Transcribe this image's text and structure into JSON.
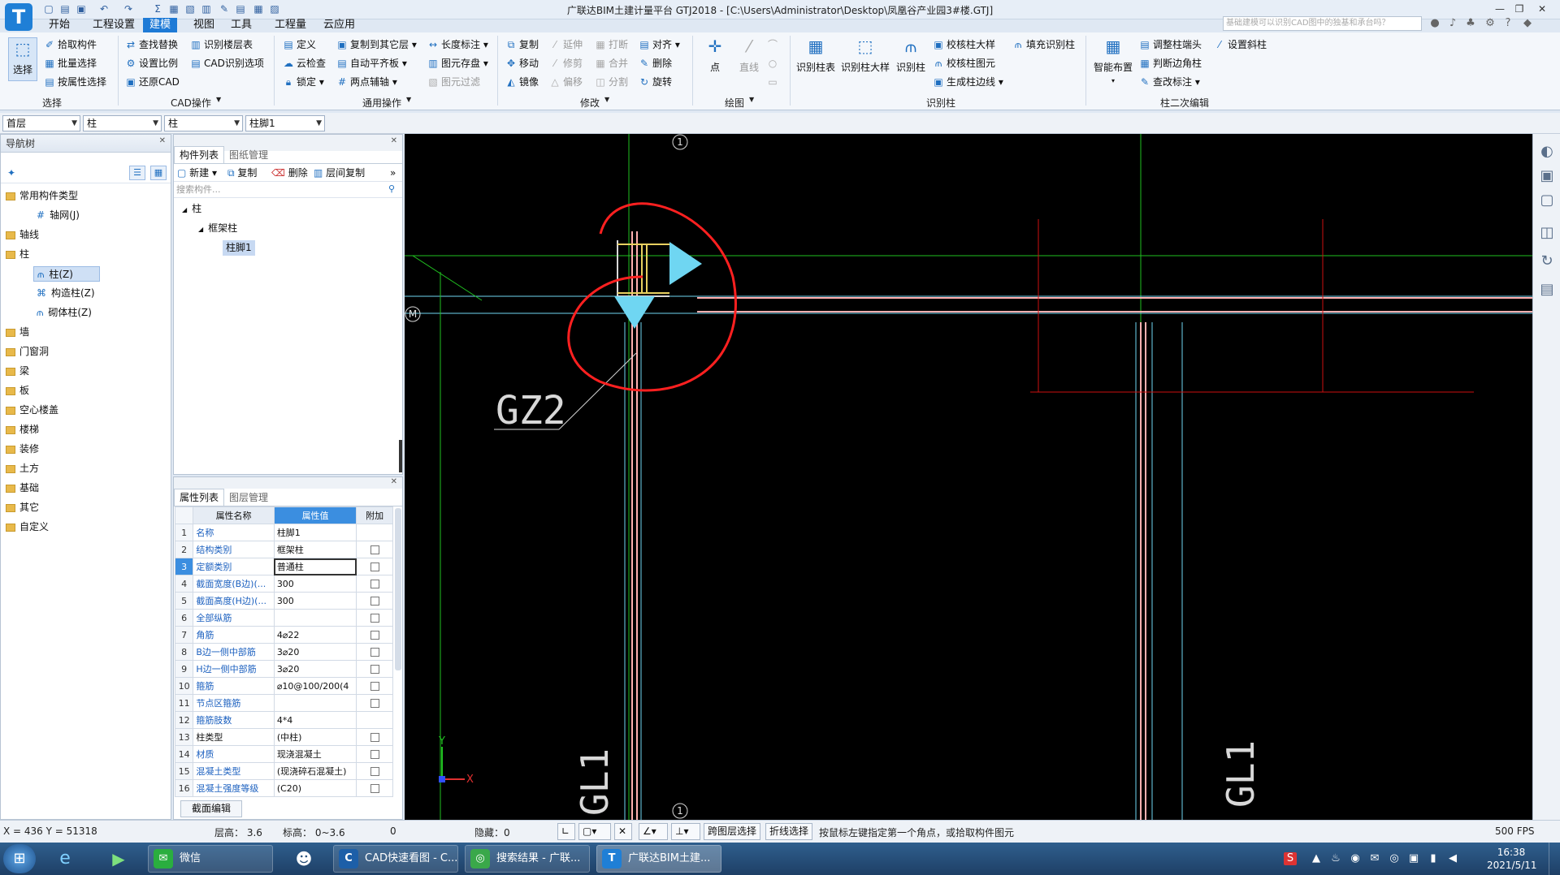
{
  "window": {
    "title": "广联达BIM土建计量平台 GTJ2018 - [C:\\Users\\Administrator\\Desktop\\凤凰谷产业园3#楼.GTJ]",
    "logo": "T",
    "controls": [
      "minimize-icon",
      "restore-icon",
      "close-icon"
    ]
  },
  "menu": {
    "items": [
      "开始",
      "工程设置",
      "建模",
      "视图",
      "工具",
      "工程量",
      "云应用"
    ],
    "active": "建模",
    "search_placeholder": "基础建模可以识别CAD图中的独基和承台吗？"
  },
  "ribbon": {
    "select_group": {
      "label": "选择",
      "big_button": "选择",
      "items": [
        "拾取构件",
        "批量选择",
        "按属性选择"
      ]
    },
    "cad_group": {
      "label": "CAD操作",
      "items": [
        "查找替换",
        "设置比例",
        "还原CAD",
        "识别楼层表",
        "CAD识别选项"
      ]
    },
    "general_group": {
      "label": "通用操作",
      "items": [
        "定义",
        "云检查",
        "锁定",
        "复制到其它层",
        "自动平齐板",
        "两点辅轴",
        "长度标注",
        "图元存盘",
        "图元过滤"
      ]
    },
    "modify_group": {
      "label": "修改",
      "items": [
        "复制",
        "移动",
        "镜像",
        "延伸",
        "修剪",
        "偏移",
        "打断",
        "合并",
        "分割",
        "对齐",
        "删除",
        "旋转"
      ]
    },
    "draw_group": {
      "label": "绘图",
      "items": [
        "点",
        "直线"
      ]
    },
    "identify_group": {
      "label": "识别柱",
      "big_buttons": [
        "识别柱表",
        "识别柱大样",
        "识别柱"
      ],
      "items": [
        "校核柱大样",
        "校核柱图元",
        "生成柱边线",
        "填充识别柱"
      ]
    },
    "column_edit_group": {
      "label": "柱二次编辑",
      "big_button": "智能布置",
      "items": [
        "调整柱端头",
        "判断边角柱",
        "查改标注",
        "设置斜柱"
      ]
    }
  },
  "selectors": [
    "首层",
    "柱",
    "柱",
    "柱脚1"
  ],
  "nav": {
    "title": "导航树",
    "items": [
      {
        "label": "常用构件类型",
        "children": [
          "轴网(J)"
        ]
      },
      {
        "label": "轴线"
      },
      {
        "label": "柱",
        "children": [
          "柱(Z)",
          "构造柱(Z)",
          "砌体柱(Z)"
        ]
      },
      {
        "label": "墙"
      },
      {
        "label": "门窗洞"
      },
      {
        "label": "梁"
      },
      {
        "label": "板"
      },
      {
        "label": "空心楼盖"
      },
      {
        "label": "楼梯"
      },
      {
        "label": "装修"
      },
      {
        "label": "土方"
      },
      {
        "label": "基础"
      },
      {
        "label": "其它"
      },
      {
        "label": "自定义"
      }
    ],
    "selected": "柱(Z)"
  },
  "components": {
    "tabs": [
      "构件列表",
      "图纸管理"
    ],
    "toolbar": [
      "新建",
      "复制",
      "删除",
      "层间复制"
    ],
    "search_placeholder": "搜索构件...",
    "tree": [
      "柱",
      "框架柱",
      "柱脚1"
    ],
    "selected": "柱脚1"
  },
  "properties": {
    "tabs": [
      "属性列表",
      "图层管理"
    ],
    "headers": [
      "属性名称",
      "属性值",
      "附加"
    ],
    "rows": [
      {
        "n": "1",
        "name": "名称",
        "value": "柱脚1",
        "check": false,
        "blue": true
      },
      {
        "n": "2",
        "name": "结构类别",
        "value": "框架柱",
        "check": true,
        "blue": true
      },
      {
        "n": "3",
        "name": "定额类别",
        "value": "普通柱",
        "check": true,
        "blue": true
      },
      {
        "n": "4",
        "name": "截面宽度(B边)(...",
        "value": "300",
        "check": true,
        "blue": true
      },
      {
        "n": "5",
        "name": "截面高度(H边)(...",
        "value": "300",
        "check": true,
        "blue": true
      },
      {
        "n": "6",
        "name": "全部纵筋",
        "value": "",
        "check": true,
        "blue": true
      },
      {
        "n": "7",
        "name": "角筋",
        "value": "4⌀22",
        "check": true,
        "blue": true
      },
      {
        "n": "8",
        "name": "B边一侧中部筋",
        "value": "3⌀20",
        "check": true,
        "blue": true
      },
      {
        "n": "9",
        "name": "H边一侧中部筋",
        "value": "3⌀20",
        "check": true,
        "blue": true
      },
      {
        "n": "10",
        "name": "箍筋",
        "value": "⌀10@100/200(4",
        "check": true,
        "blue": true
      },
      {
        "n": "11",
        "name": "节点区箍筋",
        "value": "",
        "check": true,
        "blue": true
      },
      {
        "n": "12",
        "name": "箍筋肢数",
        "value": "4*4",
        "check": false,
        "blue": true
      },
      {
        "n": "13",
        "name": "柱类型",
        "value": "(中柱)",
        "check": true,
        "blue": false
      },
      {
        "n": "14",
        "name": "材质",
        "value": "现浇混凝土",
        "check": true,
        "blue": true
      },
      {
        "n": "15",
        "name": "混凝土类型",
        "value": "(现浇碎石混凝土)",
        "check": true,
        "blue": true
      },
      {
        "n": "16",
        "name": "混凝土强度等级",
        "value": "(C20)",
        "check": true,
        "blue": true
      }
    ],
    "footer_button": "截面编辑"
  },
  "canvas": {
    "axis_top": "1",
    "axis_bottom": "1",
    "axis_left": "M",
    "label_gz2": "GZ2",
    "label_gl1": "GL1",
    "ucs_x": "X",
    "ucs_y": "Y"
  },
  "status": {
    "coords": "X = 436 Y = 51318",
    "floor_height": "层高： 3.6",
    "elevation": "标高： 0~3.6",
    "zero": "0",
    "hidden": "隐藏：0",
    "cross_layer": "跨图层选择",
    "polyline": "折线选择",
    "hint": "按鼠标左键指定第一个角点，或拾取构件图元",
    "fps": "500 FPS"
  },
  "taskbar": {
    "items": [
      "微信",
      "CAD快速看图 - C...",
      "搜索结果 - 广联...",
      "广联达BIM土建..."
    ],
    "time": "16:38",
    "date": "2021/5/11"
  },
  "colors": {
    "accent": "#1e7ad6",
    "canvas_bg": "#000000",
    "red_markup": "#ff2020",
    "cyan_marker": "#6fd6f2",
    "green_axis": "#22c322"
  }
}
